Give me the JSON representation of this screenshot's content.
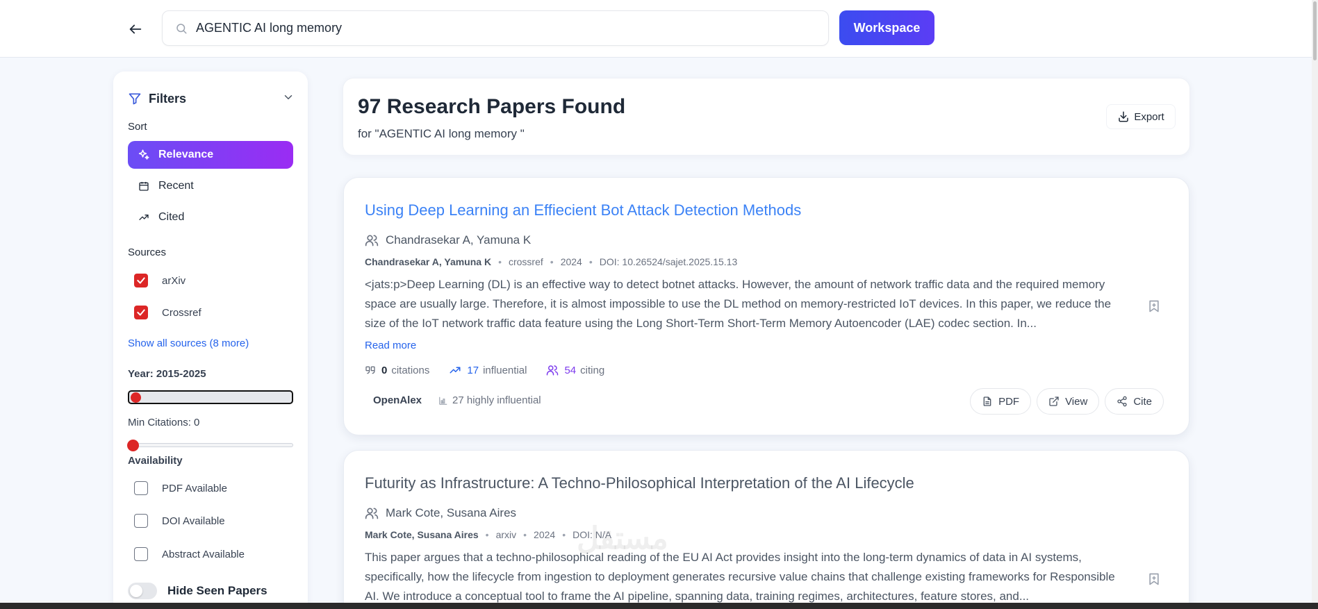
{
  "header": {
    "search_value": "AGENTIC AI long memory",
    "workspace_label": "Workspace"
  },
  "filters": {
    "title": "Filters",
    "sort_label": "Sort",
    "sort_options": [
      "Relevance",
      "Recent",
      "Cited"
    ],
    "sort_selected": "Relevance",
    "sources_label": "Sources",
    "sources": [
      {
        "label": "arXiv",
        "checked": true
      },
      {
        "label": "Crossref",
        "checked": true
      }
    ],
    "show_all_sources": "Show all sources (8 more)",
    "year_label": "Year: 2015-2025",
    "min_citations_label": "Min Citations: 0",
    "availability_label": "Availability",
    "availability": [
      {
        "label": "PDF Available",
        "checked": false
      },
      {
        "label": "DOI Available",
        "checked": false
      },
      {
        "label": "Abstract Available",
        "checked": false
      }
    ],
    "hide_seen_label": "Hide Seen Papers"
  },
  "results": {
    "count_title": "97 Research Papers Found",
    "query_sub": "for \"AGENTIC AI long memory \"",
    "export_label": "Export"
  },
  "papers": [
    {
      "title": "Using Deep Learning an Effiecient Bot Attack Detection Methods",
      "authors": "Chandrasekar A, Yamuna K",
      "meta_authors": "Chandrasekar A, Yamuna K",
      "source": "crossref",
      "year": "2024",
      "doi": "DOI: 10.26524/sajet.2025.15.13",
      "abstract": "<jats:p>Deep Learning (DL) is an effective way to detect botnet attacks. However, the amount of network traffic data and the required memory space are usually large. Therefore, it is almost impossible to use the DL method on memory-restricted IoT devices. In this paper, we reduce the size of the IoT network traffic data feature using the Long Short-Term Short-Term Memory Autoencoder (LAE) codec section. In...",
      "read_more": "Read more",
      "citations_num": "0",
      "citations_label": "citations",
      "influential_num": "17",
      "influential_label": "influential",
      "citing_num": "54",
      "citing_label": "citing",
      "provider": "OpenAlex",
      "highly_influential": "27 highly influential",
      "actions": [
        "PDF",
        "View",
        "Cite"
      ]
    },
    {
      "title": "Futurity as Infrastructure: A Techno-Philosophical Interpretation of the AI Lifecycle",
      "authors": "Mark Cote, Susana Aires",
      "meta_authors": "Mark Cote, Susana Aires",
      "source": "arxiv",
      "year": "2024",
      "doi": "DOI: N/A",
      "abstract": "This paper argues that a techno-philosophical reading of the EU AI Act provides insight into the long-term dynamics of data in AI systems, specifically, how the lifecycle from ingestion to deployment generates recursive value chains that challenge existing frameworks for Responsible AI. We introduce a conceptual tool to frame the AI pipeline, spanning data, training regimes, architectures, feature stores, and..."
    }
  ],
  "watermark": "مستقل",
  "colors": {
    "accent_blue": "#3b82f6",
    "workspace_gradient": "#3b4cf0",
    "sort_active_gradient": "#9a2cf3",
    "checkbox_red": "#dc2626"
  }
}
